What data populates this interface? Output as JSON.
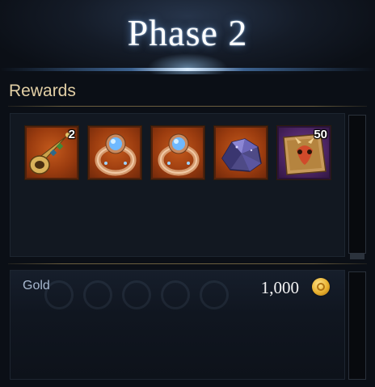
{
  "header": {
    "title": "Phase 2"
  },
  "rewards": {
    "label": "Rewards",
    "items": [
      {
        "icon": "horn-icon",
        "quantity": "2",
        "rarity": "orange"
      },
      {
        "icon": "sapphire-ring-icon",
        "quantity": "",
        "rarity": "orange"
      },
      {
        "icon": "sapphire-ring-icon",
        "quantity": "",
        "rarity": "orange"
      },
      {
        "icon": "crystal-ore-icon",
        "quantity": "",
        "rarity": "orange"
      },
      {
        "icon": "card-pack-icon",
        "quantity": "50",
        "rarity": "purple"
      }
    ]
  },
  "gold": {
    "label": "Gold",
    "amount": "1,000",
    "icon": "gold-coin-icon"
  },
  "colors": {
    "accent_gold": "#e2cfa5",
    "rarity_orange": "#c45a1c",
    "rarity_purple": "#6a3c86",
    "title_glow": "#d9ecff"
  }
}
